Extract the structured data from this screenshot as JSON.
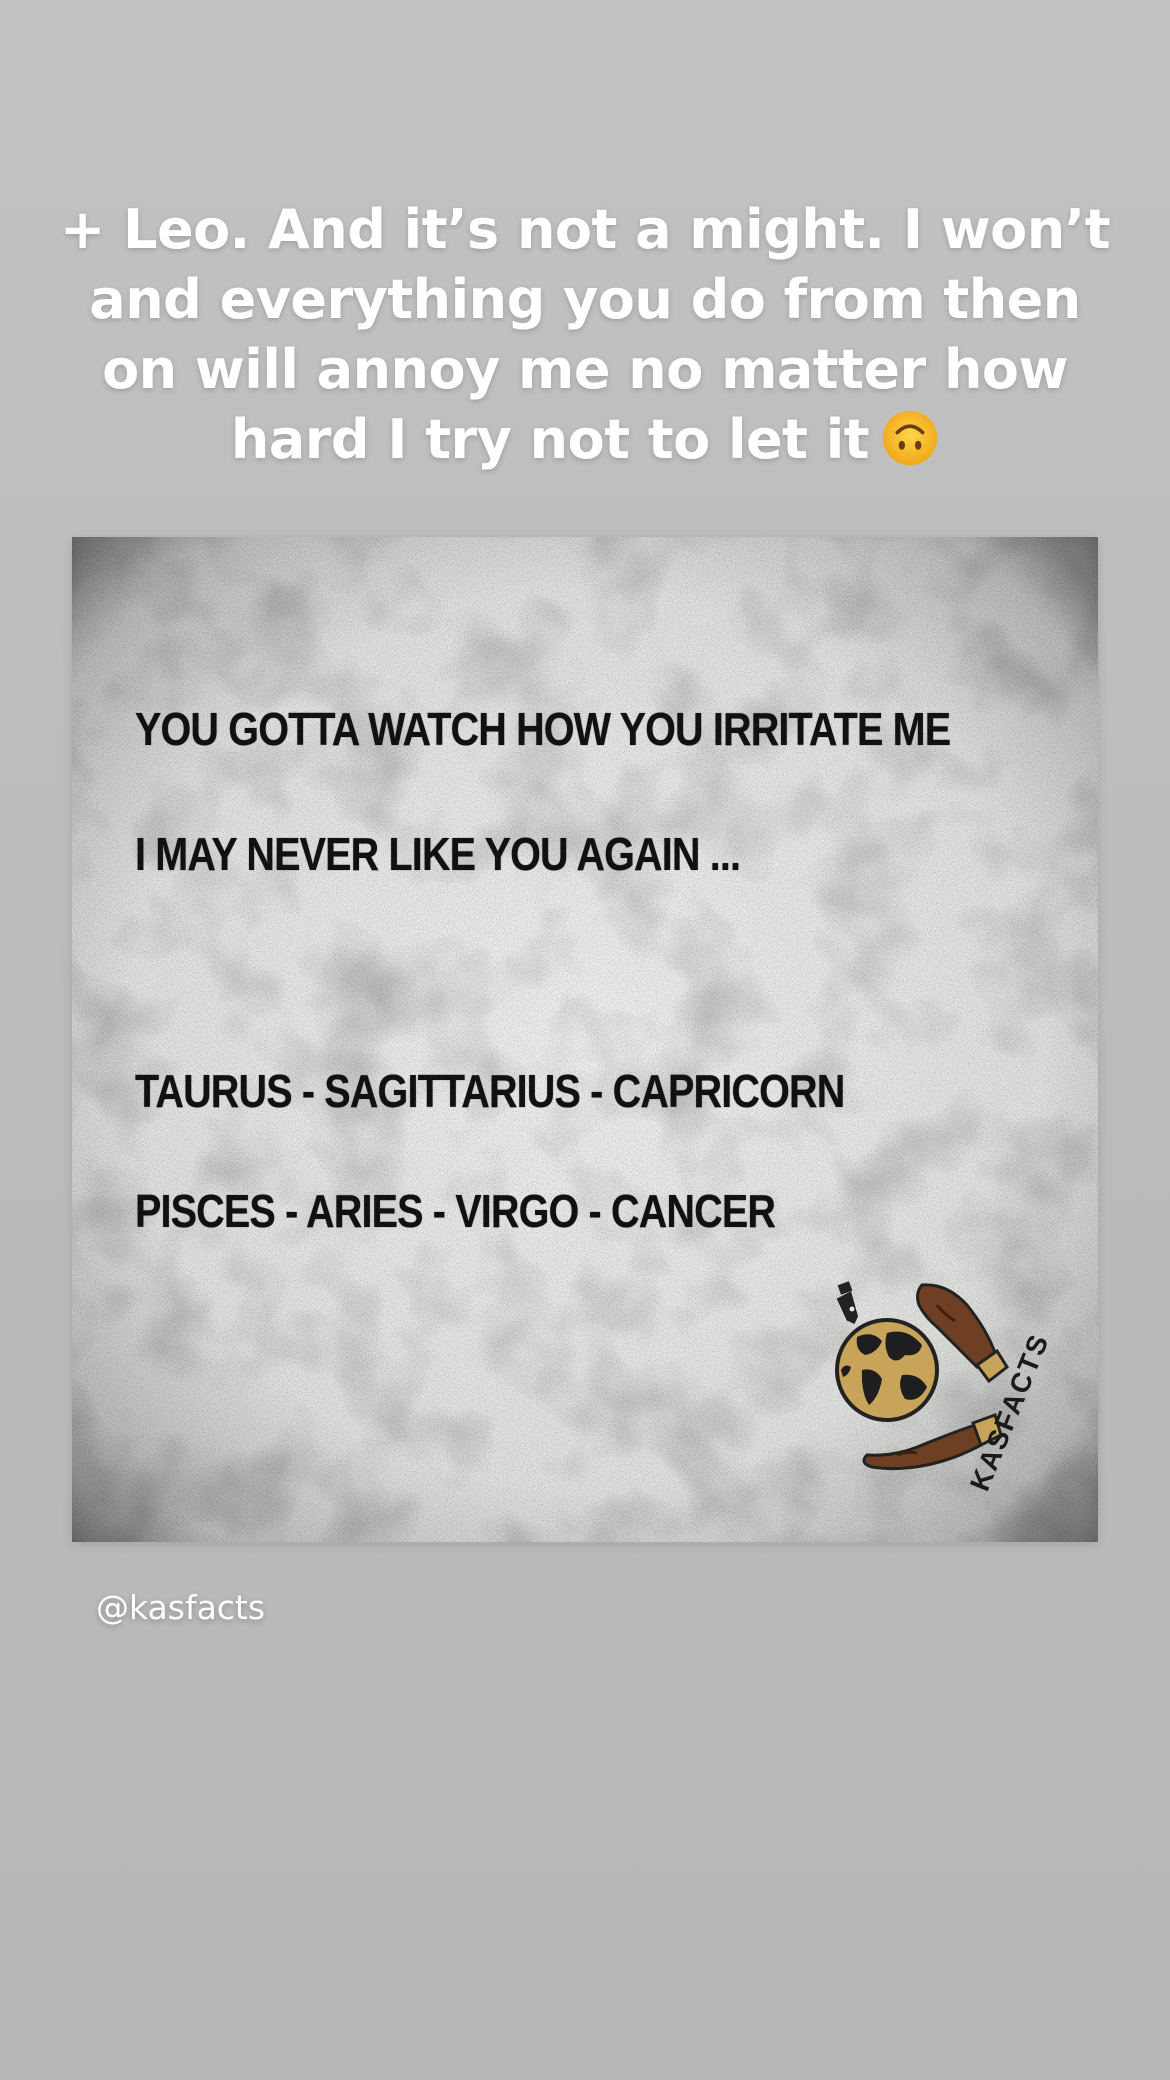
{
  "story": {
    "caption_lines": [
      "+ Leo. And it’s not a might. I won’t",
      "and everything you do from then",
      "on will annoy me no matter how",
      "hard I try not to let it"
    ],
    "caption_emoji": "upside-down-face-icon",
    "mention": "@kasfacts"
  },
  "card": {
    "line1": "YOU GOTTA WATCH HOW YOU IRRITATE ME",
    "line2": "I MAY NEVER LIKE YOU AGAIN ...",
    "line3": "TAURUS - SAGITTARIUS - CAPRICORN",
    "line4": "PISCES - ARIES - VIRGO - CANCER",
    "logo_text": "KASFACTS"
  },
  "colors": {
    "background": "#bbbbbb",
    "caption_text": "#ffffff",
    "card_text": "#111111",
    "card_paper": "#e6e6e4",
    "logo_gold": "#c7a45a"
  }
}
